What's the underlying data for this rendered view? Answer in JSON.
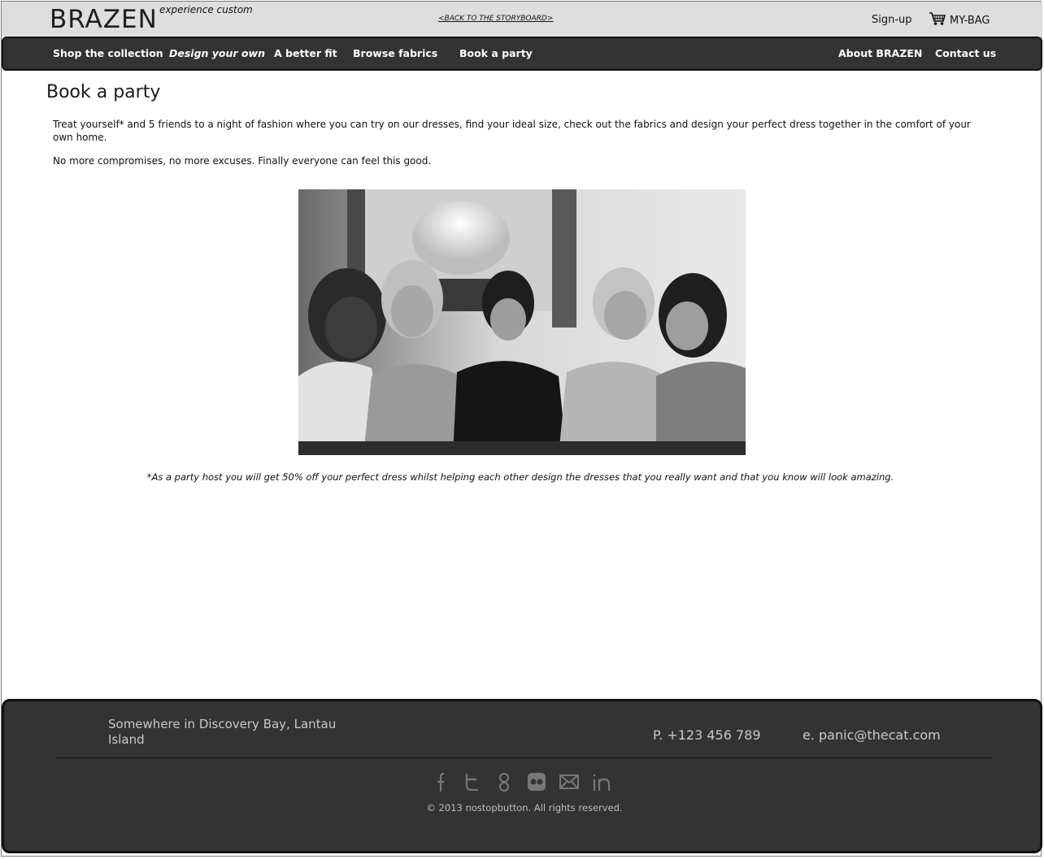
{
  "header": {
    "logo": "BRAZEN",
    "tagline": "experience custom",
    "back_link": "<BACK TO THE STORYBOARD>",
    "signup": "Sign-up",
    "bag": "MY-BAG"
  },
  "nav": {
    "items": [
      {
        "label": "Shop the collection"
      },
      {
        "label": "Design your own"
      },
      {
        "label": "A better fit"
      },
      {
        "label": "Browse fabrics"
      },
      {
        "label": "Book a party"
      },
      {
        "label": "About BRAZEN"
      },
      {
        "label": "Contact us"
      }
    ]
  },
  "main": {
    "title": "Book a party",
    "intro": "Treat yourself* and 5 friends to a night of fashion where you can try on our dresses, find your ideal size, check out the fabrics and design your perfect dress together in the comfort of your own home.",
    "intro2": "No more compromises, no more excuses. Finally everyone can feel this good.",
    "caption": "*As a party host you will get 50% off your perfect dress whilst helping each other design the dresses that you really want and that you know will look amazing."
  },
  "footer": {
    "address": "Somewhere in Discovery Bay, Lantau Island",
    "phone": "P. +123 456 789",
    "email": "e. panic@thecat.com",
    "socials": [
      "facebook-icon",
      "twitter-icon",
      "google-icon",
      "flickr-icon",
      "email-icon",
      "linkedin-icon"
    ],
    "copyright": "© 2013 nostopbutton. All rights reserved."
  }
}
